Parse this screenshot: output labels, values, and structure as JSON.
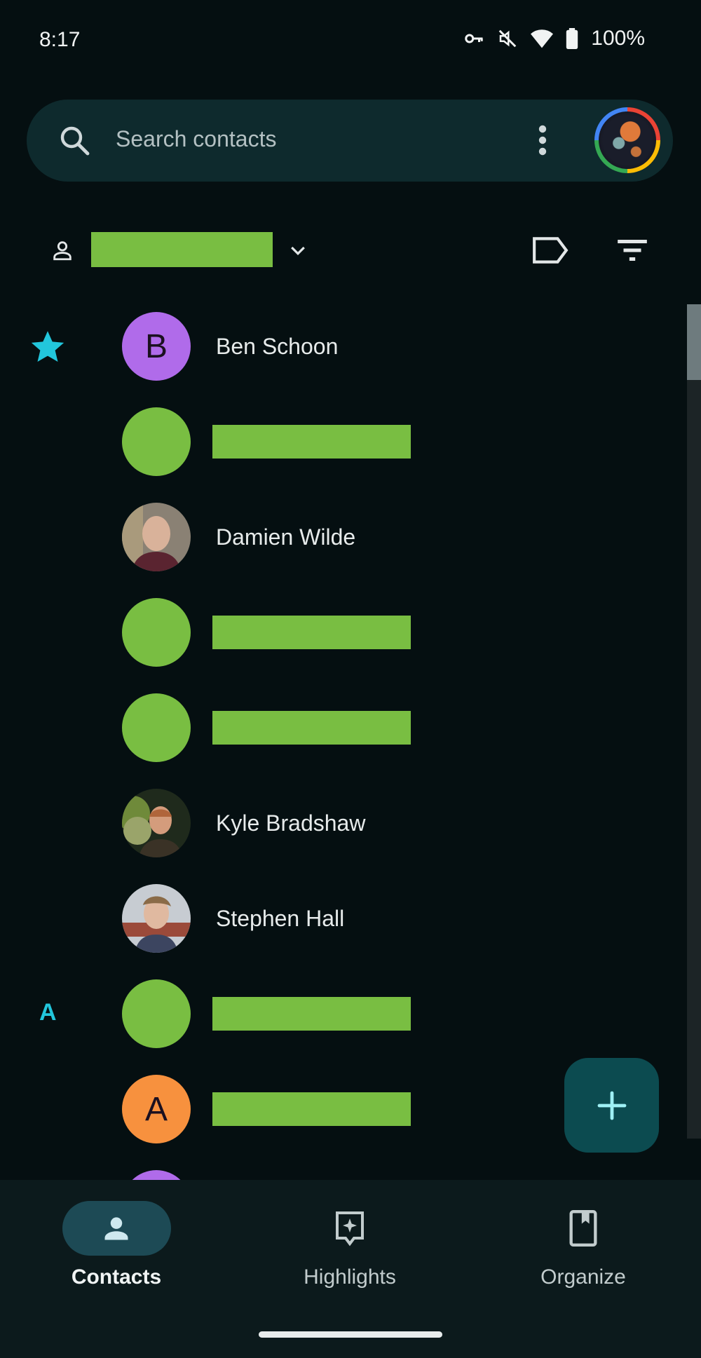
{
  "status_bar": {
    "time": "8:17",
    "battery": "100%",
    "icons": [
      "vpn-key-icon",
      "muted-icon",
      "wifi-icon",
      "battery-icon"
    ]
  },
  "search": {
    "placeholder": "Search contacts",
    "icons": [
      "search-icon",
      "more-vert-icon",
      "account-avatar"
    ]
  },
  "account_row": {
    "icons": [
      "person-icon",
      "chevron-down-icon",
      "label-icon",
      "filter-icon"
    ]
  },
  "sections": {
    "starred_icon": "star-icon",
    "letter_a": "A"
  },
  "contacts": [
    {
      "name": "Ben Schoon",
      "avatar_type": "letter",
      "avatar_letter": "B",
      "avatar_color": "#b06bea"
    },
    {
      "name": "",
      "avatar_type": "redacted",
      "avatar_color": "#79be42"
    },
    {
      "name": "Damien Wilde",
      "avatar_type": "photo"
    },
    {
      "name": "",
      "avatar_type": "redacted",
      "avatar_color": "#79be42"
    },
    {
      "name": "",
      "avatar_type": "redacted",
      "avatar_color": "#79be42"
    },
    {
      "name": "Kyle Bradshaw",
      "avatar_type": "photo"
    },
    {
      "name": "Stephen Hall",
      "avatar_type": "photo"
    },
    {
      "name": "",
      "avatar_type": "redacted",
      "avatar_color": "#79be42"
    },
    {
      "name": "",
      "avatar_type": "letter",
      "avatar_letter": "A",
      "avatar_color": "#f7913e"
    }
  ],
  "fab": {
    "icon": "add-icon"
  },
  "bottom_nav": [
    {
      "label": "Contacts",
      "icon": "person-icon",
      "active": true
    },
    {
      "label": "Highlights",
      "icon": "highlights-icon",
      "active": false
    },
    {
      "label": "Organize",
      "icon": "bookmark-icon",
      "active": false
    }
  ],
  "colors": {
    "background": "#050f11",
    "accent": "#22c6dc",
    "redaction": "#79be42",
    "fab": "#0c4b50"
  }
}
